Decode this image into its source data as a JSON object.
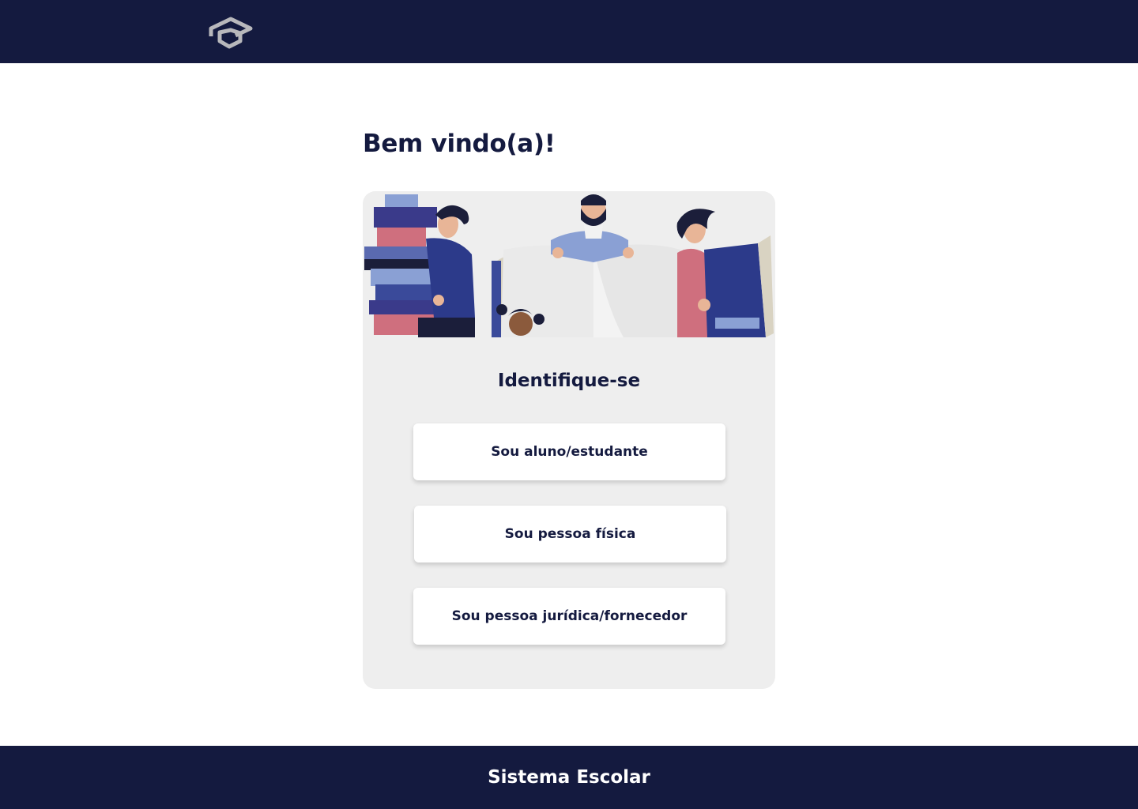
{
  "header": {
    "logo_icon": "graduation-cap-icon",
    "background_color": "#141a3f"
  },
  "main": {
    "welcome_title": "Bem vindo(a)!",
    "card": {
      "illustration": "people-with-books-illustration",
      "title": "Identifique-se",
      "options": [
        {
          "label": "Sou aluno/estudante"
        },
        {
          "label": "Sou pessoa física"
        },
        {
          "label": "Sou pessoa jurídica/fornecedor"
        }
      ],
      "background_color": "#eeeeee"
    }
  },
  "footer": {
    "title": "Sistema Escolar",
    "background_color": "#141a3f"
  }
}
